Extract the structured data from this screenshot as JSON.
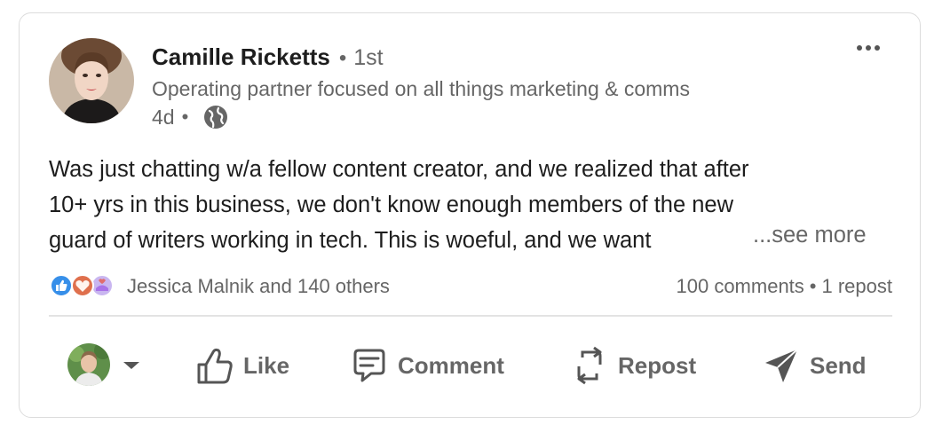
{
  "post": {
    "author": {
      "name": "Camille Ricketts",
      "degree": "1st",
      "headline": "Operating partner focused on all things marketing & comms",
      "posted": "4d",
      "visibility_icon": "globe-icon"
    },
    "body": {
      "line1": "Was just chatting w/a fellow content creator, and we realized that after",
      "line2": "10+ yrs in this business, we don't know enough members of the new",
      "line3": "guard of writers working in tech. This is woeful, and we want",
      "see_more": "...see more"
    },
    "social": {
      "reaction_icons": [
        "like-icon",
        "love-icon",
        "support-icon"
      ],
      "reactors": "Jessica Malnik and 140 others",
      "comments": "100 comments",
      "reposts": "1 repost"
    },
    "actions": {
      "like": "Like",
      "comment": "Comment",
      "repost": "Repost",
      "send": "Send"
    }
  },
  "colors": {
    "text_primary": "#1d1d1d",
    "text_secondary": "#666666",
    "like_blue": "#378fe9",
    "love_red": "#df704d",
    "support_purple": "#a872e8"
  }
}
